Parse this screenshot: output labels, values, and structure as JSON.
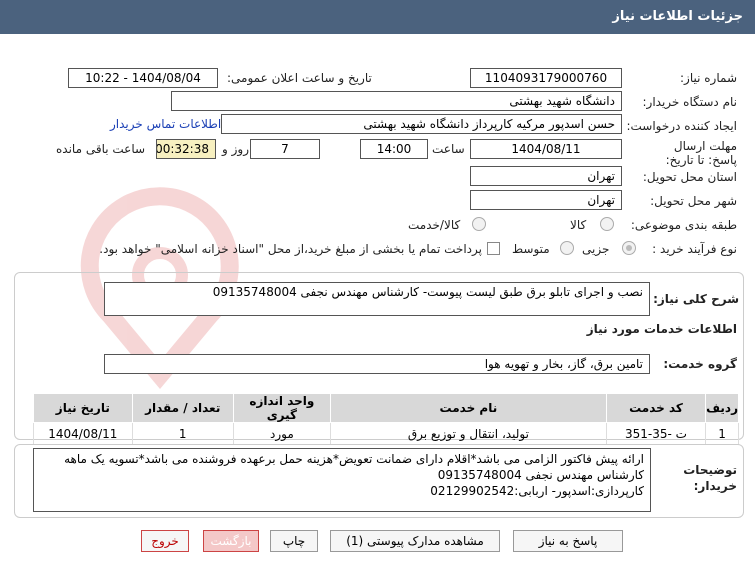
{
  "header": {
    "title": "جزئیات اطلاعات نیاز"
  },
  "fields": {
    "need_number_label": "شماره نیاز:",
    "need_number": "1104093179000760",
    "announce_label": "تاریخ و ساعت اعلان عمومی:",
    "announce_value": "1404/08/04 - 10:22",
    "buyer_org_label": "نام دستگاه خریدار:",
    "buyer_org": "دانشگاه شهید بهشتی",
    "creator_label": "ایجاد کننده درخواست:",
    "creator": "حسن اسدپور مرکیه کارپرداز دانشگاه شهید بهشتی",
    "contact_link": "اطلاعات تماس خریدار",
    "deadline_label": "مهلت ارسال پاسخ: تا تاریخ:",
    "deadline_date": "1404/08/11",
    "time_label": "ساعت",
    "deadline_time": "14:00",
    "days_value": "7",
    "days_label": "روز و",
    "remaining_time": "00:32:38",
    "remaining_label": "ساعت باقی مانده",
    "province_label": "استان محل تحویل:",
    "province": "تهران",
    "city_label": "شهر محل تحویل:",
    "city": "تهران",
    "category_label": "طبقه بندی موضوعی:",
    "category_options": [
      "کالا",
      "کالا/خدمت"
    ],
    "process_label": "نوع فرآیند خرید :",
    "process_options": [
      "جزیی",
      "متوسط"
    ],
    "payment_note": "پرداخت تمام یا بخشی از مبلغ خرید،از محل \"اسناد خزانه اسلامی\" خواهد بود."
  },
  "summary": {
    "label": "شرح کلی نیاز:",
    "text": "نصب و اجرای تابلو برق طبق لیست پیوست- کارشناس مهندس نجفی 09135748004"
  },
  "services": {
    "title": "اطلاعات خدمات مورد نیاز",
    "group_label": "گروه خدمت:",
    "group_value": "تامین برق، گاز، بخار و تهویه هوا"
  },
  "table": {
    "headers": [
      "ردیف",
      "کد خدمت",
      "نام خدمت",
      "واحد اندازه گیری",
      "تعداد / مقدار",
      "تاریخ نیاز"
    ],
    "rows": [
      [
        "1",
        "ت -35-351",
        "تولید، انتقال و توزیع برق",
        "مورد",
        "1",
        "1404/08/11"
      ]
    ]
  },
  "buyer_notes": {
    "label": "توضیحات خریدار:",
    "lines": [
      "ارائه پیش فاکتور الزامی می باشد*اقلام دارای ضمانت تعویض*هزینه حمل برعهده فروشنده می باشد*تسویه یک ماهه",
      "کارشناس مهندس نجفی 09135748004",
      "کارپردازی:اسدپور- اربابی:02129902542"
    ]
  },
  "buttons": {
    "reply": "پاسخ به نیاز",
    "attachments": "مشاهده مدارک پیوستی (1)",
    "print": "چاپ",
    "back": "بازگشت",
    "exit": "خروج"
  },
  "colors": {
    "header_bg": "#4b627e",
    "watermark": "#e8c8c8"
  }
}
